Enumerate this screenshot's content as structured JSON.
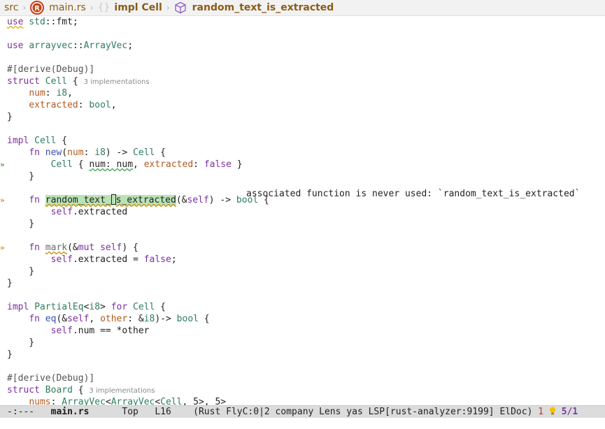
{
  "breadcrumb": {
    "segments": [
      "src",
      "main.rs",
      "{}",
      "impl Cell",
      "random_text_is_extracted"
    ],
    "icons": [
      "rust-logo-icon",
      "braces-icon",
      "module-cube-icon"
    ]
  },
  "code": {
    "lines": [
      "use std::fmt;",
      "",
      "use arrayvec::ArrayVec;",
      "",
      "#[derive(Debug)]",
      "struct Cell {",
      "    num: i8,",
      "    extracted: bool,",
      "}",
      "",
      "impl Cell {",
      "    fn new(num: i8) -> Cell {",
      "        Cell { num: num, extracted: false }",
      "    }",
      "",
      "    fn random_text_is_extracted(&self) -> bool {",
      "        self.extracted",
      "    }",
      "",
      "    fn mark(&mut self) {",
      "        self.extracted = false;",
      "    }",
      "}",
      "",
      "impl PartialEq<i8> for Cell {",
      "    fn eq(&self, other: &i8)-> bool {",
      "        self.num == *other",
      "    }",
      "}",
      "",
      "#[derive(Debug)]",
      "struct Board {",
      "    nums: ArrayVec<ArrayVec<Cell, 5>, 5>"
    ],
    "lens_hints": [
      "3 implementations",
      "3 implementations"
    ],
    "diagnostic": "associated function is never used: `random_text_is_extracted`"
  },
  "fringe": {
    "marks": [
      "»",
      "»",
      "»"
    ],
    "colors": [
      "#3fa34d",
      "#e08a00",
      "#e08a00"
    ]
  },
  "modeline": {
    "status": "-:---",
    "file": "main.rs",
    "position": "Top",
    "line": "L16",
    "modes": "(Rust FlyC:0|2 company Lens yas LSP[rust-analyzer:9199] ElDoc)",
    "errors": "1",
    "bulb_icon": "lightbulb-icon",
    "counter": "5/1"
  },
  "colors": {
    "keyword": "#7b2fa0",
    "type": "#2e7d5b",
    "function": "#3b4cb8",
    "field": "#b05a1f",
    "highlight": "#b9e3b5",
    "modeline_bg": "#dcdcdc"
  }
}
